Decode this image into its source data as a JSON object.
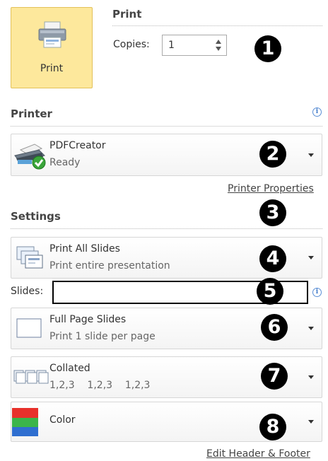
{
  "print_section": {
    "button_label": "Print",
    "title": "Print",
    "copies_label": "Copies:",
    "copies_value": "1"
  },
  "printer_section": {
    "title": "Printer",
    "name": "PDFCreator",
    "status": "Ready",
    "properties_link": "Printer Properties"
  },
  "settings_section": {
    "title": "Settings",
    "slides_range": {
      "main": "Print All Slides",
      "sub": "Print entire presentation"
    },
    "slides_label": "Slides:",
    "slides_value": "",
    "layout": {
      "main": "Full Page Slides",
      "sub": "Print 1 slide per page"
    },
    "collation": {
      "main": "Collated",
      "sub": "1,2,3    1,2,3    1,2,3"
    },
    "color": {
      "main": "Color"
    },
    "header_footer_link": "Edit Header & Footer"
  },
  "badges": [
    "1",
    "2",
    "3",
    "4",
    "5",
    "6",
    "7",
    "8"
  ],
  "colors": {
    "button_bg": "#fde89c",
    "button_border": "#e3c15a",
    "info_blue": "#3d78c8",
    "badge": "#000000"
  },
  "icons": {
    "print_button": "printer-icon",
    "printer": "printer-ready-icon",
    "slides_range": "slides-stack-icon",
    "layout": "full-page-slide-icon",
    "collation": "collated-pages-icon",
    "color": "color-swatch-icon",
    "info": "info-icon"
  }
}
